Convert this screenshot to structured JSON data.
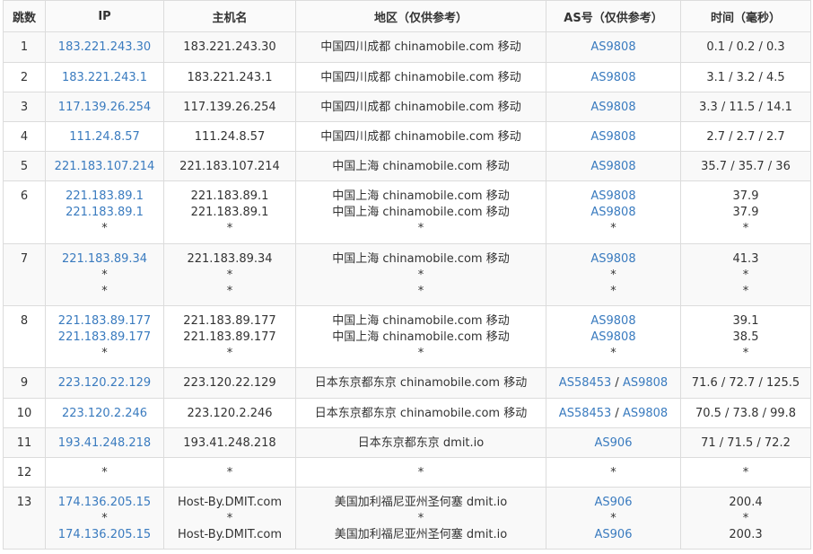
{
  "headers": [
    "跳数",
    "IP",
    "主机名",
    "地区（仅供参考）",
    "AS号（仅供参考）",
    "时间（毫秒）"
  ],
  "rows": [
    {
      "hop": "1",
      "ips": [
        "183.221.243.30"
      ],
      "hosts": [
        "183.221.243.30"
      ],
      "regions": [
        "中国四川成都 chinamobile.com 移动"
      ],
      "as": [
        [
          "AS9808"
        ]
      ],
      "times": [
        "0.1 / 0.2 / 0.3"
      ]
    },
    {
      "hop": "2",
      "ips": [
        "183.221.243.1"
      ],
      "hosts": [
        "183.221.243.1"
      ],
      "regions": [
        "中国四川成都 chinamobile.com 移动"
      ],
      "as": [
        [
          "AS9808"
        ]
      ],
      "times": [
        "3.1 / 3.2 / 4.5"
      ]
    },
    {
      "hop": "3",
      "ips": [
        "117.139.26.254"
      ],
      "hosts": [
        "117.139.26.254"
      ],
      "regions": [
        "中国四川成都 chinamobile.com 移动"
      ],
      "as": [
        [
          "AS9808"
        ]
      ],
      "times": [
        "3.3 / 11.5 / 14.1"
      ]
    },
    {
      "hop": "4",
      "ips": [
        "111.24.8.57"
      ],
      "hosts": [
        "111.24.8.57"
      ],
      "regions": [
        "中国四川成都 chinamobile.com 移动"
      ],
      "as": [
        [
          "AS9808"
        ]
      ],
      "times": [
        "2.7 / 2.7 / 2.7"
      ]
    },
    {
      "hop": "5",
      "ips": [
        "221.183.107.214"
      ],
      "hosts": [
        "221.183.107.214"
      ],
      "regions": [
        "中国上海 chinamobile.com 移动"
      ],
      "as": [
        [
          "AS9808"
        ]
      ],
      "times": [
        "35.7 / 35.7 / 36"
      ]
    },
    {
      "hop": "6",
      "ips": [
        "221.183.89.1",
        "221.183.89.1",
        "*"
      ],
      "hosts": [
        "221.183.89.1",
        "221.183.89.1",
        "*"
      ],
      "regions": [
        "中国上海 chinamobile.com 移动",
        "中国上海 chinamobile.com 移动",
        "*"
      ],
      "as": [
        [
          "AS9808"
        ],
        [
          "AS9808"
        ],
        [
          "*"
        ]
      ],
      "times": [
        "37.9",
        "37.9",
        "*"
      ]
    },
    {
      "hop": "7",
      "ips": [
        "221.183.89.34",
        "*",
        "*"
      ],
      "hosts": [
        "221.183.89.34",
        "*",
        "*"
      ],
      "regions": [
        "中国上海 chinamobile.com 移动",
        "*",
        "*"
      ],
      "as": [
        [
          "AS9808"
        ],
        [
          "*"
        ],
        [
          "*"
        ]
      ],
      "times": [
        "41.3",
        "*",
        "*"
      ]
    },
    {
      "hop": "8",
      "ips": [
        "221.183.89.177",
        "221.183.89.177",
        "*"
      ],
      "hosts": [
        "221.183.89.177",
        "221.183.89.177",
        "*"
      ],
      "regions": [
        "中国上海 chinamobile.com 移动",
        "中国上海 chinamobile.com 移动",
        "*"
      ],
      "as": [
        [
          "AS9808"
        ],
        [
          "AS9808"
        ],
        [
          "*"
        ]
      ],
      "times": [
        "39.1",
        "38.5",
        "*"
      ]
    },
    {
      "hop": "9",
      "ips": [
        "223.120.22.129"
      ],
      "hosts": [
        "223.120.22.129"
      ],
      "regions": [
        "日本东京都东京 chinamobile.com 移动"
      ],
      "as": [
        [
          "AS58453",
          "AS9808"
        ]
      ],
      "times": [
        "71.6 / 72.7 / 125.5"
      ]
    },
    {
      "hop": "10",
      "ips": [
        "223.120.2.246"
      ],
      "hosts": [
        "223.120.2.246"
      ],
      "regions": [
        "日本东京都东京 chinamobile.com 移动"
      ],
      "as": [
        [
          "AS58453",
          "AS9808"
        ]
      ],
      "times": [
        "70.5 / 73.8 / 99.8"
      ]
    },
    {
      "hop": "11",
      "ips": [
        "193.41.248.218"
      ],
      "hosts": [
        "193.41.248.218"
      ],
      "regions": [
        "日本东京都东京 dmit.io"
      ],
      "as": [
        [
          "AS906"
        ]
      ],
      "times": [
        "71 / 71.5 / 72.2"
      ]
    },
    {
      "hop": "12",
      "ips": [
        "*"
      ],
      "hosts": [
        "*"
      ],
      "regions": [
        "*"
      ],
      "as": [
        [
          "*"
        ]
      ],
      "times": [
        "*"
      ]
    },
    {
      "hop": "13",
      "ips": [
        "174.136.205.15",
        "*",
        "174.136.205.15"
      ],
      "hosts": [
        "Host-By.DMIT.com",
        "*",
        "Host-By.DMIT.com"
      ],
      "regions": [
        "美国加利福尼亚州圣何塞 dmit.io",
        "*",
        "美国加利福尼亚州圣何塞 dmit.io"
      ],
      "as": [
        [
          "AS906"
        ],
        [
          "*"
        ],
        [
          "AS906"
        ]
      ],
      "times": [
        "200.4",
        "*",
        "200.3"
      ]
    }
  ],
  "as_separator": " / ",
  "colors": {
    "link": "#3a7bbf",
    "border": "#dcdcdc",
    "row_alt": "#f9f9f9",
    "header_bg": "#fafafa"
  }
}
